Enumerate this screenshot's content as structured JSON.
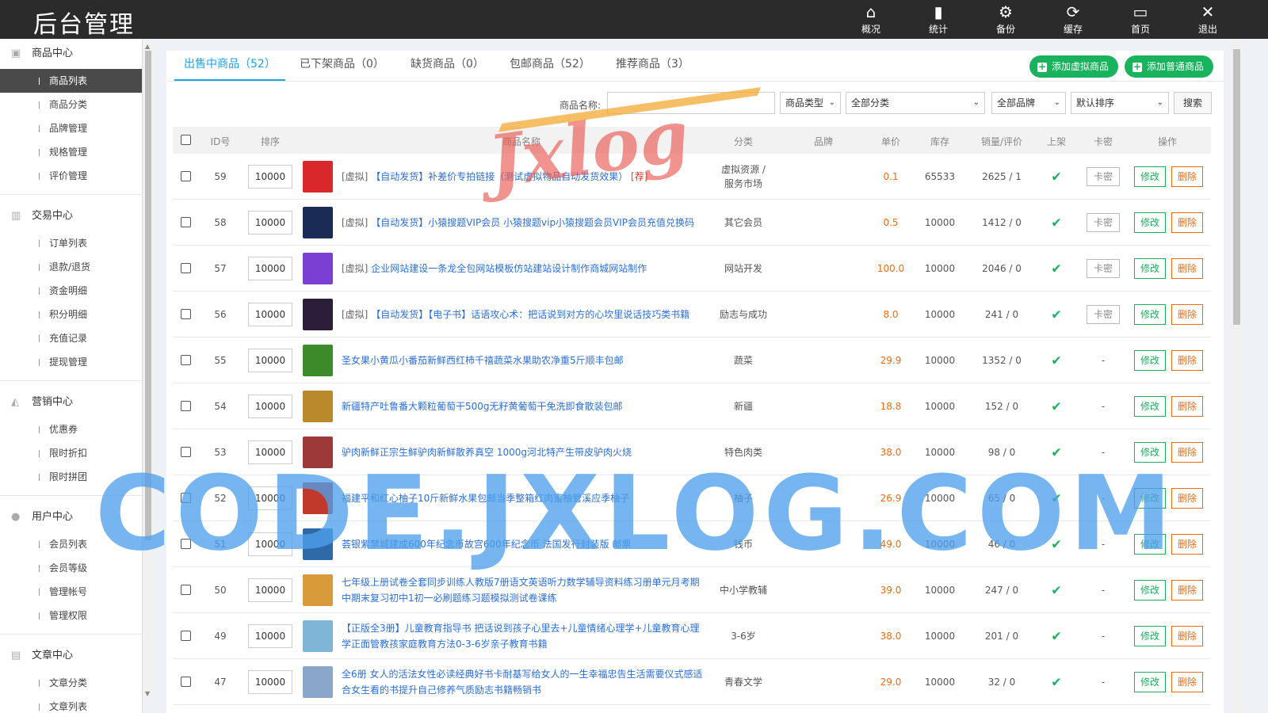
{
  "header": {
    "title": "后台管理",
    "nav": [
      {
        "label": "概况",
        "icon": "home-icon"
      },
      {
        "label": "统计",
        "icon": "bar-chart-icon"
      },
      {
        "label": "备份",
        "icon": "gear-icon"
      },
      {
        "label": "缓存",
        "icon": "refresh-icon"
      },
      {
        "label": "首页",
        "icon": "monitor-icon"
      },
      {
        "label": "退出",
        "icon": "close-icon"
      }
    ]
  },
  "sidebar": {
    "groups": [
      {
        "title": "商品中心",
        "icon": "box-icon",
        "items": [
          "商品列表",
          "商品分类",
          "品牌管理",
          "规格管理",
          "评价管理"
        ]
      },
      {
        "title": "交易中心",
        "icon": "bar-chart-icon",
        "items": [
          "订单列表",
          "退款/退货",
          "资金明细",
          "积分明细",
          "充值记录",
          "提现管理"
        ]
      },
      {
        "title": "营销中心",
        "icon": "area-chart-icon",
        "items": [
          "优惠券",
          "限时折扣",
          "限时拼团"
        ]
      },
      {
        "title": "用户中心",
        "icon": "user-icon",
        "items": [
          "会员列表",
          "会员等级",
          "管理帐号",
          "管理权限"
        ]
      },
      {
        "title": "文章中心",
        "icon": "document-icon",
        "items": [
          "文章分类",
          "文章列表"
        ]
      }
    ],
    "active": "商品列表"
  },
  "tabs": [
    {
      "label": "出售中商品（52）",
      "active": true
    },
    {
      "label": "已下架商品（0）",
      "active": false
    },
    {
      "label": "缺货商品（0）",
      "active": false
    },
    {
      "label": "包邮商品（52）",
      "active": false
    },
    {
      "label": "推荐商品（3）",
      "active": false
    }
  ],
  "actions": {
    "add_virtual": "添加虚拟商品",
    "add_normal": "添加普通商品"
  },
  "filters": {
    "name_label": "商品名称:",
    "name_value": "",
    "type": "商品类型",
    "category": "全部分类",
    "brand": "全部品牌",
    "sort": "默认排序",
    "search": "搜索"
  },
  "table": {
    "headers": [
      "ID号",
      "排序",
      "商品名称",
      "分类",
      "品牌",
      "单价",
      "库存",
      "销量/评价",
      "上架",
      "卡密",
      "操作"
    ],
    "key_label": "卡密",
    "edit_label": "修改",
    "delete_label": "删除",
    "no_key": "-",
    "check_mark": "✔",
    "rows": [
      {
        "id": "59",
        "sort": "10000",
        "prefix": "[虚拟]",
        "name": "【自动发货】补差价专拍链接（测试虚拟物品自动发货效果）",
        "tag": "[荐]",
        "category": "虚拟资源 / 服务市场",
        "brand": "",
        "price": "0.1",
        "stock": "65533",
        "sales": "2625 / 1",
        "key": true,
        "thumb_color": "#d8282b"
      },
      {
        "id": "58",
        "sort": "10000",
        "prefix": "[虚拟]",
        "name": "【自动发货】小猿搜题VIP会员 小猿搜题vip小猿搜题会员VIP会员充值兑换码",
        "tag": "",
        "category": "其它会员",
        "brand": "",
        "price": "0.5",
        "stock": "10000",
        "sales": "1412 / 0",
        "key": true,
        "thumb_color": "#1a2c56"
      },
      {
        "id": "57",
        "sort": "10000",
        "prefix": "[虚拟]",
        "name": "企业网站建设一条龙全包网站模板仿站建站设计制作商城网站制作",
        "tag": "",
        "category": "网站开发",
        "brand": "",
        "price": "100.0",
        "stock": "10000",
        "sales": "2046 / 0",
        "key": true,
        "thumb_color": "#7b3fd4"
      },
      {
        "id": "56",
        "sort": "10000",
        "prefix": "[虚拟]",
        "name": "【自动发货】【电子书】话语攻心术：把话说到对方的心坎里说话技巧类书籍",
        "tag": "",
        "category": "励志与成功",
        "brand": "",
        "price": "8.0",
        "stock": "10000",
        "sales": "241 / 0",
        "key": true,
        "thumb_color": "#2a1e3a"
      },
      {
        "id": "55",
        "sort": "10000",
        "prefix": "",
        "name": "圣女果小黄瓜小番茄新鲜西红柿千禧蔬菜水果助农净重5斤顺丰包邮",
        "tag": "",
        "category": "蔬菜",
        "brand": "",
        "price": "29.9",
        "stock": "10000",
        "sales": "1352 / 0",
        "key": false,
        "thumb_color": "#3d8a2a"
      },
      {
        "id": "54",
        "sort": "10000",
        "prefix": "",
        "name": "新疆特产吐鲁番大颗粒葡萄干500g无籽黄葡萄干免洗即食散装包邮",
        "tag": "",
        "category": "新疆",
        "brand": "",
        "price": "18.8",
        "stock": "10000",
        "sales": "152 / 0",
        "key": false,
        "thumb_color": "#b88a2c"
      },
      {
        "id": "53",
        "sort": "10000",
        "prefix": "",
        "name": "驴肉新鲜正宗生鲜驴肉新鲜散养真空 1000g河北特产生带皮驴肉火烧",
        "tag": "",
        "category": "特色肉类",
        "brand": "",
        "price": "38.0",
        "stock": "10000",
        "sales": "98 / 0",
        "key": false,
        "thumb_color": "#9c3a3a"
      },
      {
        "id": "52",
        "sort": "10000",
        "prefix": "",
        "name": "福建平和红心柚子10斤新鲜水果包邮当季整箱红肉蜜柚管溪应季柚子",
        "tag": "",
        "category": "柚子",
        "brand": "",
        "price": "26.9",
        "stock": "10000",
        "sales": "65 / 0",
        "key": false,
        "thumb_color": "#c0392b"
      },
      {
        "id": "51",
        "sort": "10000",
        "prefix": "",
        "name": "荟银紫禁城建成600年纪念币故宫600年纪念币 法国发行封装版 邮票",
        "tag": "",
        "category": "钱币",
        "brand": "",
        "price": "49.0",
        "stock": "10000",
        "sales": "46 / 0",
        "key": false,
        "thumb_color": "#2e6aa8"
      },
      {
        "id": "50",
        "sort": "10000",
        "prefix": "",
        "name": "七年级上册试卷全套同步训练人教版7册语文英语听力数学辅导资料练习册单元月考期中期末复习初中1初一必刷题练习题模拟测试卷课练",
        "tag": "",
        "category": "中小学教辅",
        "brand": "",
        "price": "39.0",
        "stock": "10000",
        "sales": "247 / 0",
        "key": false,
        "thumb_color": "#d89a3a"
      },
      {
        "id": "49",
        "sort": "10000",
        "prefix": "",
        "name": "【正版全3册】儿童教育指导书 把话说到孩子心里去+儿童情绪心理学+儿童教育心理学正面管教孩家庭教育方法0-3-6岁亲子教育书籍",
        "tag": "",
        "category": "3-6岁",
        "brand": "",
        "price": "38.0",
        "stock": "10000",
        "sales": "201 / 0",
        "key": false,
        "thumb_color": "#7fb6d8"
      },
      {
        "id": "47",
        "sort": "10000",
        "prefix": "",
        "name": "全6册 女人的活法女性必读经典好书卡耐基写给女人的一生幸福忠告生活需要仪式感适合女生看的书提升自己修养气质励志书籍畅销书",
        "tag": "",
        "category": "青春文学",
        "brand": "",
        "price": "29.0",
        "stock": "10000",
        "sales": "32 / 0",
        "key": false,
        "thumb_color": "#8aa6c8"
      }
    ]
  },
  "watermarks": {
    "top": "Jxlog",
    "center": "CODE.JXLOG.COM"
  }
}
